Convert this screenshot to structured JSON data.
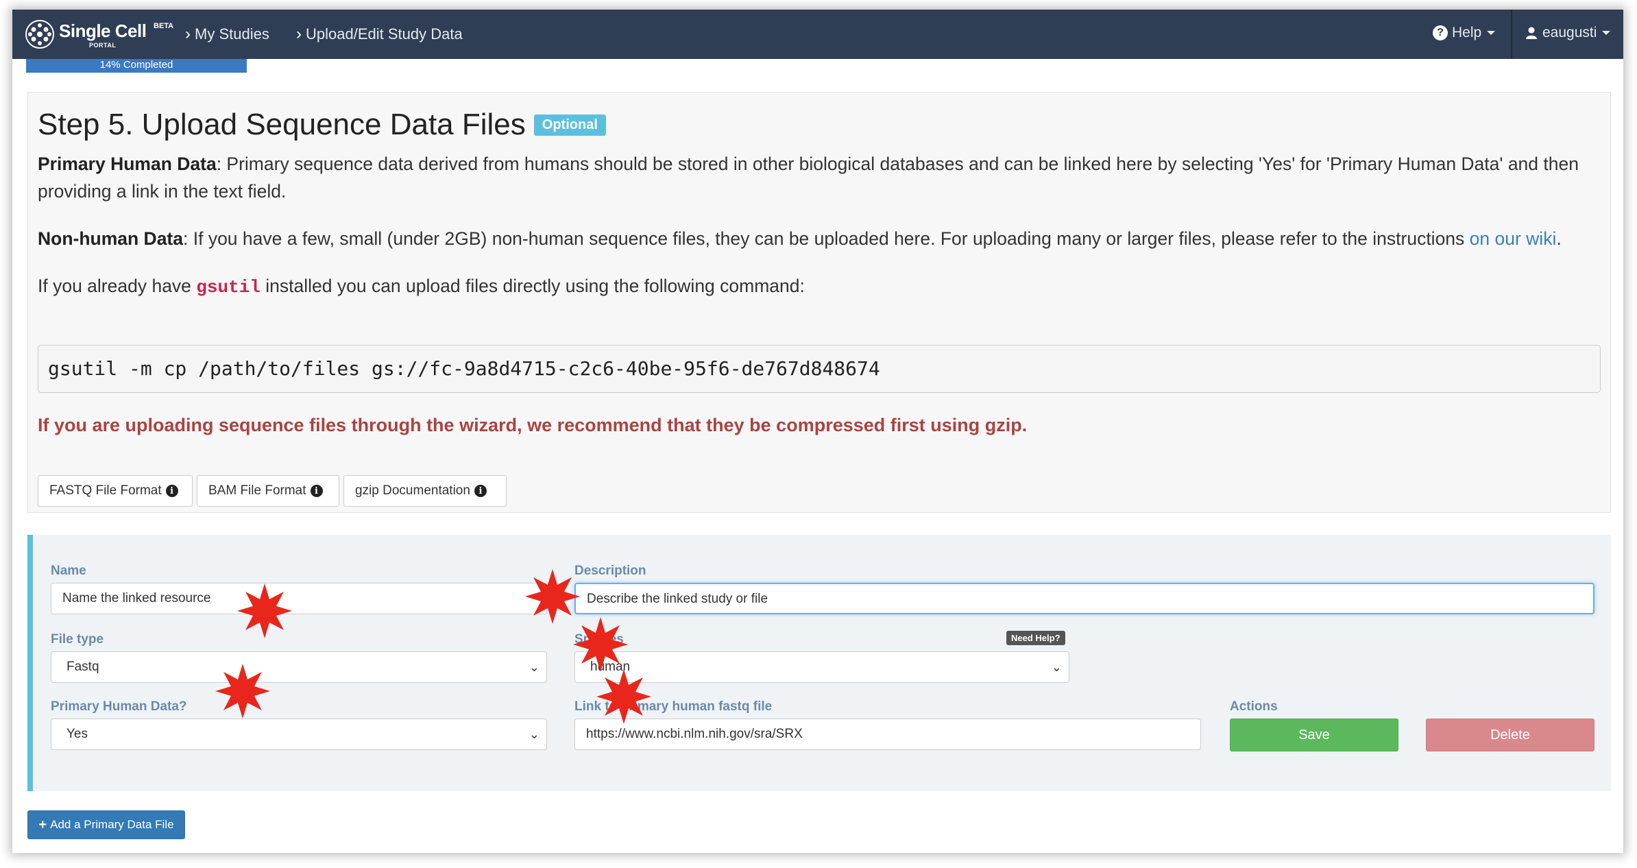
{
  "navbar": {
    "logo_title": "Single Cell",
    "logo_beta": "BETA",
    "logo_portal": "PORTAL",
    "breadcrumbs": [
      "My Studies",
      "Upload/Edit Study Data"
    ],
    "help_label": "Help",
    "user_label": "eaugusti"
  },
  "progress": {
    "label": "14% Completed",
    "value_percent": 14
  },
  "step": {
    "title": "Step 5. Upload Sequence Data Files",
    "badge": "Optional",
    "primary_heading": "Primary Human Data",
    "primary_text": ": Primary sequence data derived from humans should be stored in other biological databases and can be linked here by selecting 'Yes' for 'Primary Human Data' and then providing a link in the text field.",
    "nonhuman_heading": "Non-human Data",
    "nonhuman_text": ": If you have a few, small (under 2GB) non-human sequence files, they can be uploaded here. For uploading many or larger files, please refer to the instructions ",
    "nonhuman_link": "on our wiki",
    "nonhuman_end": ".",
    "gsutil_pre": "If you already have ",
    "gsutil_code": "gsutil",
    "gsutil_post": " installed you can upload files directly using the following command:",
    "command": "gsutil -m cp /path/to/files gs://fc-9a8d4715-c2c6-40be-95f6-de767d848674",
    "warning": "If you are uploading sequence files through the wizard, we recommend that they be compressed first using gzip.",
    "doc_buttons": [
      "FASTQ File Format",
      "BAM File Format",
      "gzip Documentation"
    ]
  },
  "form": {
    "name_label": "Name",
    "name_value": "Name the linked resource",
    "description_label": "Description",
    "description_value": "Describe the linked study or file",
    "file_type_label": "File type",
    "file_type_value": "Fastq",
    "species_label": "Species",
    "need_help": "Need Help?",
    "species_value": "human",
    "primary_label": "Primary Human Data?",
    "primary_value": "Yes",
    "link_label": "Link to primary human fastq file",
    "link_value": "https://www.ncbi.nlm.nih.gov/sra/SRX",
    "actions_label": "Actions",
    "save_label": "Save",
    "delete_label": "Delete"
  },
  "add_button": "Add a Primary Data File",
  "colors": {
    "navbar": "#2f3e55",
    "progress": "#3a7ac2",
    "badge": "#5bc0de",
    "warning": "#a94442",
    "save": "#5cb85c",
    "delete": "#d9888b",
    "add_button": "#337ab7",
    "annotation_star": "#e8261c"
  },
  "icons": [
    "logo-icon",
    "chevron-right-icon",
    "question-circle-icon",
    "user-icon",
    "info-circle-icon",
    "chevron-down-icon",
    "plus-icon",
    "red-star-annotation"
  ]
}
